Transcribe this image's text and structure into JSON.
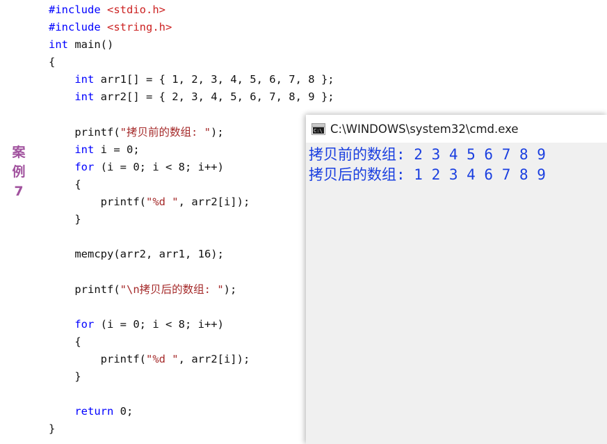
{
  "editor": {
    "margin_note": {
      "chars": [
        "案",
        "例",
        "7"
      ],
      "color": "#a1529e"
    },
    "colors": {
      "keyword": "#0000ff",
      "header": "#cc2222",
      "string": "#a52a2a",
      "plain": "#111111",
      "background": "#ffffff"
    },
    "code_lines": [
      [
        {
          "t": "#include ",
          "c": "pp"
        },
        {
          "t": "<stdio.h>",
          "c": "hdr"
        }
      ],
      [
        {
          "t": "#include ",
          "c": "pp"
        },
        {
          "t": "<string.h>",
          "c": "hdr"
        }
      ],
      [
        {
          "t": "int",
          "c": "kw"
        },
        {
          "t": " main()",
          "c": "pl"
        }
      ],
      [
        {
          "t": "{",
          "c": "pl"
        }
      ],
      [
        {
          "t": "    ",
          "c": "pl"
        },
        {
          "t": "int",
          "c": "kw"
        },
        {
          "t": " arr1[] = { 1, 2, 3, 4, 5, 6, 7, 8 };",
          "c": "pl"
        }
      ],
      [
        {
          "t": "    ",
          "c": "pl"
        },
        {
          "t": "int",
          "c": "kw"
        },
        {
          "t": " arr2[] = { 2, 3, 4, 5, 6, 7, 8, 9 };",
          "c": "pl"
        }
      ],
      [],
      [
        {
          "t": "    printf(",
          "c": "pl"
        },
        {
          "t": "\"拷贝前的数组: \"",
          "c": "str"
        },
        {
          "t": ");",
          "c": "pl"
        }
      ],
      [
        {
          "t": "    ",
          "c": "pl"
        },
        {
          "t": "int",
          "c": "kw"
        },
        {
          "t": " i = 0;",
          "c": "pl"
        }
      ],
      [
        {
          "t": "    ",
          "c": "pl"
        },
        {
          "t": "for",
          "c": "kw"
        },
        {
          "t": " (i = 0; i < 8; i++)",
          "c": "pl"
        }
      ],
      [
        {
          "t": "    {",
          "c": "pl"
        }
      ],
      [
        {
          "t": "        printf(",
          "c": "pl"
        },
        {
          "t": "\"%d \"",
          "c": "str"
        },
        {
          "t": ", arr2[i]);",
          "c": "pl"
        }
      ],
      [
        {
          "t": "    }",
          "c": "pl"
        }
      ],
      [],
      [
        {
          "t": "    memcpy(arr2, arr1, 16);",
          "c": "pl"
        }
      ],
      [],
      [
        {
          "t": "    printf(",
          "c": "pl"
        },
        {
          "t": "\"\\n拷贝后的数组: \"",
          "c": "str"
        },
        {
          "t": ");",
          "c": "pl"
        }
      ],
      [],
      [
        {
          "t": "    ",
          "c": "pl"
        },
        {
          "t": "for",
          "c": "kw"
        },
        {
          "t": " (i = 0; i < 8; i++)",
          "c": "pl"
        }
      ],
      [
        {
          "t": "    {",
          "c": "pl"
        }
      ],
      [
        {
          "t": "        printf(",
          "c": "pl"
        },
        {
          "t": "\"%d \"",
          "c": "str"
        },
        {
          "t": ", arr2[i]);",
          "c": "pl"
        }
      ],
      [
        {
          "t": "    }",
          "c": "pl"
        }
      ],
      [],
      [
        {
          "t": "    ",
          "c": "pl"
        },
        {
          "t": "return",
          "c": "kw"
        },
        {
          "t": " 0;",
          "c": "pl"
        }
      ],
      [
        {
          "t": "}",
          "c": "pl"
        }
      ]
    ]
  },
  "console": {
    "title": "C:\\WINDOWS\\system32\\cmd.exe",
    "icon_label": "C:\\",
    "icon_name": "cmd-console-icon",
    "text_color": "#1a3fe0",
    "background": "#f0f0f0",
    "titlebar_background": "#ffffff",
    "output_lines": [
      "拷贝前的数组: 2 3 4 5 6 7 8 9",
      "拷贝后的数组: 1 2 3 4 6 7 8 9 "
    ]
  }
}
